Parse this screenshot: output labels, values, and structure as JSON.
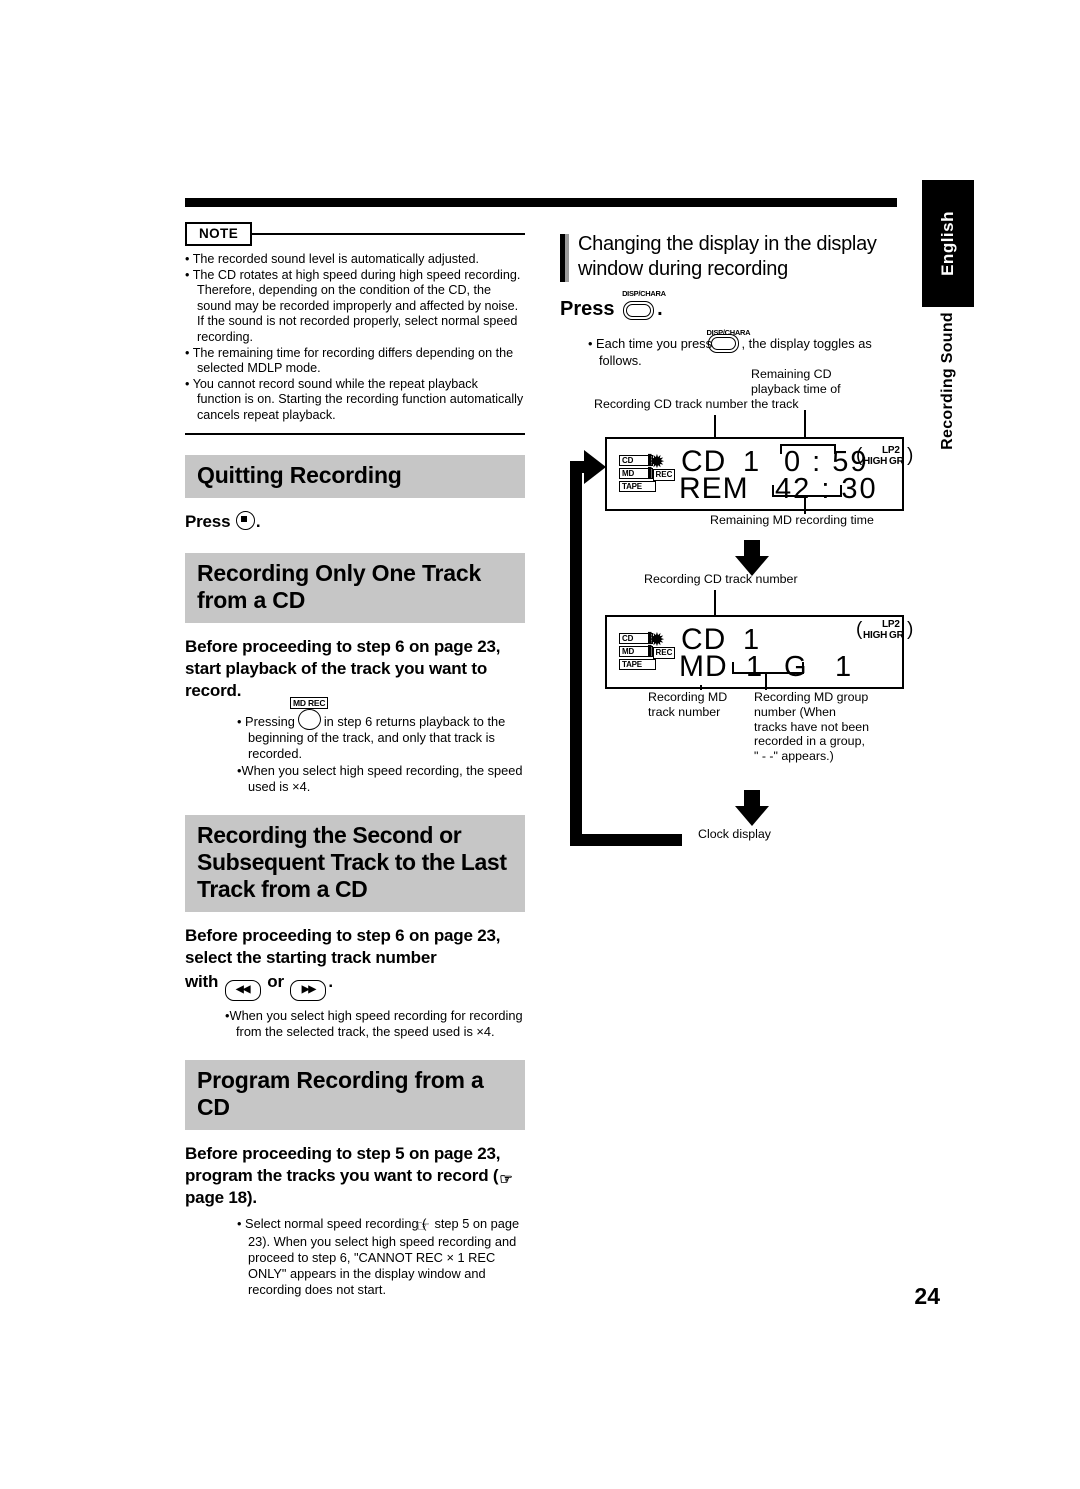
{
  "meta": {
    "page_number": "24",
    "language_tab": "English",
    "section_tab": "Recording Sound"
  },
  "note": {
    "badge": "NOTE",
    "items": [
      "The recorded sound level is automatically adjusted.",
      "The CD rotates at high speed during high speed recording. Therefore, depending on the condition of the CD, the sound may be recorded improperly and affected by noise. If the sound is not recorded properly, select normal speed recording.",
      "The remaining time for recording differs depending on the selected MDLP mode.",
      "You cannot record sound while the repeat playback function is on. Starting the recording function automatically cancels repeat playback."
    ]
  },
  "sections": [
    {
      "heading": "Quitting Recording",
      "instruction_prefix": "Press",
      "instruction_suffix": ".",
      "bullets": []
    },
    {
      "heading": "Recording Only One Track from a CD",
      "instruction": "Before proceeding to step 6 on page 23, start playback of the track you want to record.",
      "button_tag": "MD REC",
      "bullets": [
        "Pressing  in step 6 returns playback to the beginning of the track, and only that track is recorded.",
        "When you select high speed recording, the speed used is ×4."
      ],
      "bullet1_before": "Pressing",
      "bullet1_after": "in step 6 returns playback to the beginning of the track, and only that track is recorded."
    },
    {
      "heading": "Recording the Second or Subsequent Track to the Last Track from a CD",
      "instruction_line1": "Before proceeding to step 6 on page 23, select the starting track number",
      "instruction_line2_before": "with",
      "instruction_line2_mid": "or",
      "instruction_line2_after": ".",
      "skip_back_glyph": "◀◀",
      "skip_fwd_glyph": "▶▶",
      "bullets": [
        "When you select high speed recording for recording from the selected track, the speed used is ×4."
      ]
    },
    {
      "heading": "Program Recording from a CD",
      "instruction_line1": "Before proceeding to step 5 on page 23, program the tracks you want to",
      "instruction_line2_before": "record (",
      "instruction_line2_after": "page 18).",
      "bullets": [
        "Select normal speed recording (☞ step 5 on page 23). When you select high speed recording and proceed to step 6, \"CANNOT REC × 1 REC ONLY\" appears in the display window and recording does not start."
      ],
      "bullet_part1_before": "Select normal speed recording (",
      "bullet_part1_after": "step 5 on page 23).",
      "bullet_part2": "When you select high speed recording and proceed to step 6, \"CANNOT REC × 1 REC ONLY\" appears in the display window and recording does not start."
    }
  ],
  "right_column": {
    "heading": "Changing the display in the display window during recording",
    "press_label": "Press",
    "press_period": ".",
    "button_tag": "DISP/CHARA",
    "bullet_before": "Each time you press",
    "bullet_after": ", the display toggles as follows."
  },
  "diagram": {
    "labels": {
      "cd_track_number_1": "Recording CD track number",
      "remaining_cd": "Remaining CD playback time of the track",
      "remaining_md": "Remaining MD recording time",
      "cd_track_number_2": "Recording CD track number",
      "md_track_number": "Recording MD track number",
      "md_group_number": "Recording MD group number (When tracks have not been recorded in a group, \" - -\" appears.)",
      "clock_display": "Clock display"
    },
    "display1": {
      "indicators": [
        "CD",
        "MD",
        "TAPE"
      ],
      "rec_tag": "REC",
      "row1_label": "CD",
      "row1_track": "1",
      "row1_time": "0 : 59",
      "row2_label": "REM",
      "row2_time": "42 : 30",
      "mode_high": "HIGH",
      "mode_lp2": "LP2",
      "mode_gr": "GR",
      "paren_left": "(",
      "paren_right": ")"
    },
    "display2": {
      "indicators": [
        "CD",
        "MD",
        "TAPE"
      ],
      "rec_tag": "REC",
      "row1_label": "CD",
      "row1_track": "1",
      "row2_label": "MD",
      "row2_track": "1",
      "row2_group_letter": "G",
      "row2_group_num": "1",
      "mode_high": "HIGH",
      "mode_lp2": "LP2",
      "mode_gr": "GR",
      "paren_left": "(",
      "paren_right": ")"
    }
  }
}
